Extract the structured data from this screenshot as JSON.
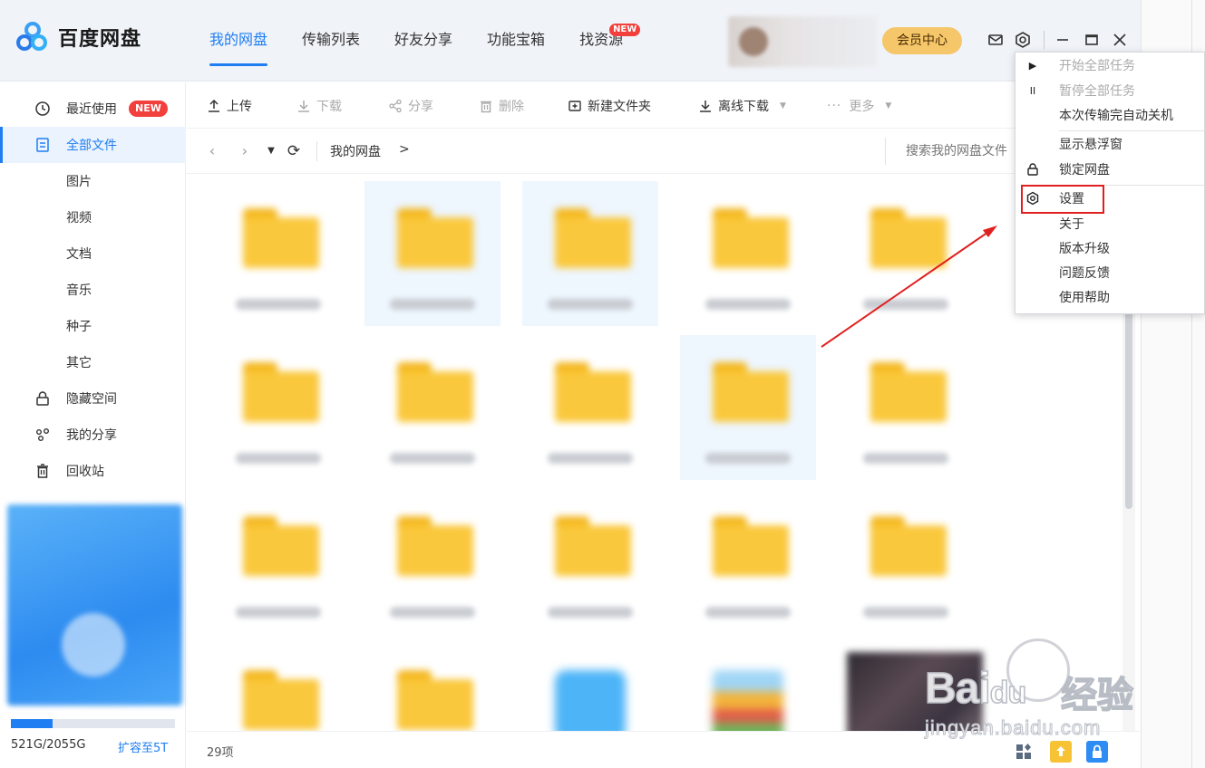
{
  "app": {
    "name": "百度网盘"
  },
  "tabs": [
    {
      "label": "我的网盘",
      "active": true
    },
    {
      "label": "传输列表"
    },
    {
      "label": "好友分享"
    },
    {
      "label": "功能宝箱"
    },
    {
      "label": "找资源",
      "badge": "NEW"
    }
  ],
  "header": {
    "vip_label": "会员中心",
    "icons": [
      "mail-icon",
      "gear-icon",
      "minimize-icon",
      "maximize-icon",
      "close-icon"
    ]
  },
  "sidebar": {
    "items": [
      {
        "label": "最近使用",
        "icon": "clock-icon",
        "badge": "NEW"
      },
      {
        "label": "全部文件",
        "icon": "file-icon",
        "active": true
      },
      {
        "label": "图片"
      },
      {
        "label": "视频"
      },
      {
        "label": "文档"
      },
      {
        "label": "音乐"
      },
      {
        "label": "种子"
      },
      {
        "label": "其它"
      },
      {
        "label": "隐藏空间",
        "icon": "lock-icon"
      },
      {
        "label": "我的分享",
        "icon": "share-icon"
      },
      {
        "label": "回收站",
        "icon": "trash-icon"
      }
    ],
    "storage": {
      "text": "521G/2055G",
      "used_fraction": 0.2535,
      "expand_label": "扩容至5T"
    }
  },
  "toolbar": {
    "upload": "上传",
    "download": "下载",
    "share": "分享",
    "delete": "删除",
    "new_folder": "新建文件夹",
    "offline_download": "离线下载",
    "more": "更多"
  },
  "breadcrumb": {
    "root": "我的网盘",
    "separator": ">"
  },
  "search": {
    "placeholder": "搜索我的网盘文件"
  },
  "status": {
    "count": "29项"
  },
  "menu": {
    "items": [
      {
        "label": "开始全部任务",
        "disabled": true,
        "icon": "play-icon"
      },
      {
        "label": "暂停全部任务",
        "disabled": true,
        "icon": "pause-icon"
      },
      {
        "label": "本次传输完自动关机"
      },
      {
        "label": "显示悬浮窗"
      },
      {
        "label": "锁定网盘",
        "icon": "lock-icon"
      },
      {
        "label": "设置",
        "icon": "gear-icon",
        "highlighted": true
      },
      {
        "label": "关于"
      },
      {
        "label": "版本升级"
      },
      {
        "label": "问题反馈"
      },
      {
        "label": "使用帮助"
      }
    ]
  },
  "watermark": {
    "brand": "Bai",
    "brand_du": "du",
    "cn": "经验",
    "url": "jingyan.baidu.com"
  },
  "colors": {
    "accent": "#1f7ef2",
    "folder": "#fac83c",
    "vip": "#f5c66a",
    "highlight_red": "#e02020",
    "badge_red": "#f2403c"
  }
}
